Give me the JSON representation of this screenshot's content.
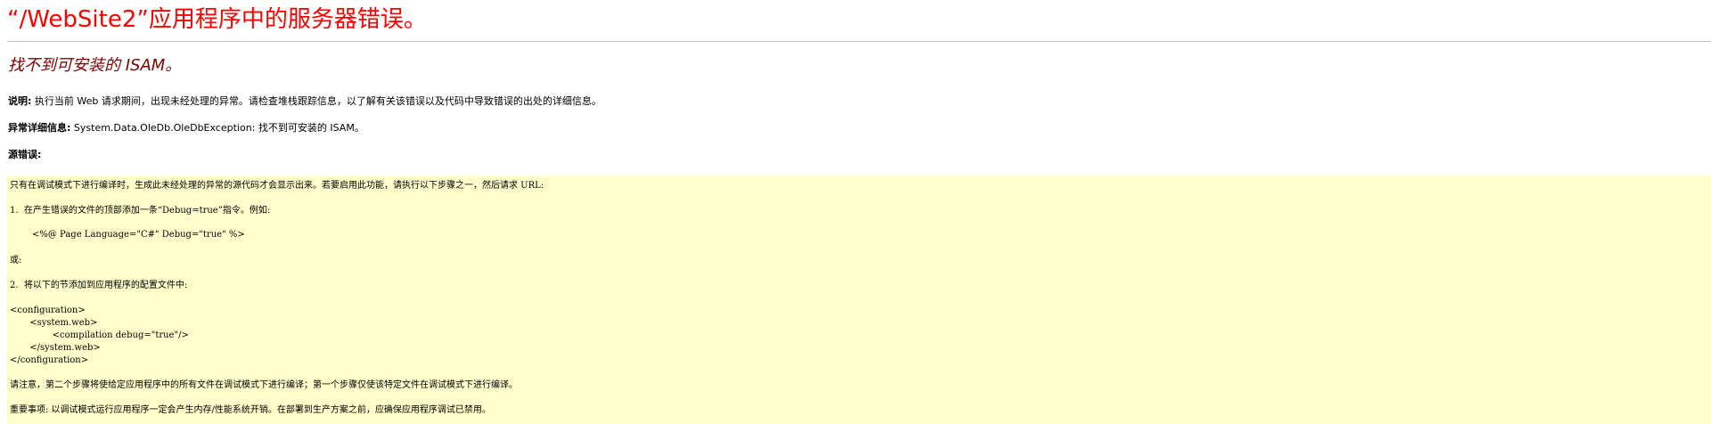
{
  "page": {
    "title": "“/WebSite2”应用程序中的服务器错误。",
    "error_message": "找不到可安装的 ISAM。"
  },
  "description": {
    "label": "说明:",
    "text": " 执行当前 Web 请求期间，出现未经处理的异常。请检查堆栈跟踪信息，以了解有关该错误以及代码中导致错误的出处的详细信息。"
  },
  "exception_details": {
    "label": "异常详细信息:",
    "text": " System.Data.OleDb.OleDbException: 找不到可安装的 ISAM。"
  },
  "source_error": {
    "label": "源错误:"
  },
  "source_box": {
    "intro": "只有在调试模式下进行编译时，生成此未经处理的异常的源代码才会显示出来。若要启用此功能，请执行以下步骤之一，然后请求 URL:",
    "step1": "1.  在产生错误的文件的顶部添加一条“Debug=true”指令。例如:",
    "step1_code": "<%@ Page Language=\"C#\" Debug=\"true\" %>",
    "or": "或:",
    "step2": "2.  将以下的节添加到应用程序的配置文件中:",
    "config": "<configuration>\n       <system.web>\n               <compilation debug=\"true\"/>\n       </system.web>\n</configuration>",
    "note": "请注意，第二个步骤将使给定应用程序中的所有文件在调试模式下进行编译；第一个步骤仅使该特定文件在调试模式下进行编译。",
    "important": "重要事项: 以调试模式运行应用程序一定会产生内存/性能系统开销。在部署到生产方案之前，应确保应用程序调试已禁用。"
  },
  "colors": {
    "title": "#ff0000",
    "error_message": "#800000",
    "source_box_background": "#ffffcc",
    "rule": "#c0c0c0"
  }
}
